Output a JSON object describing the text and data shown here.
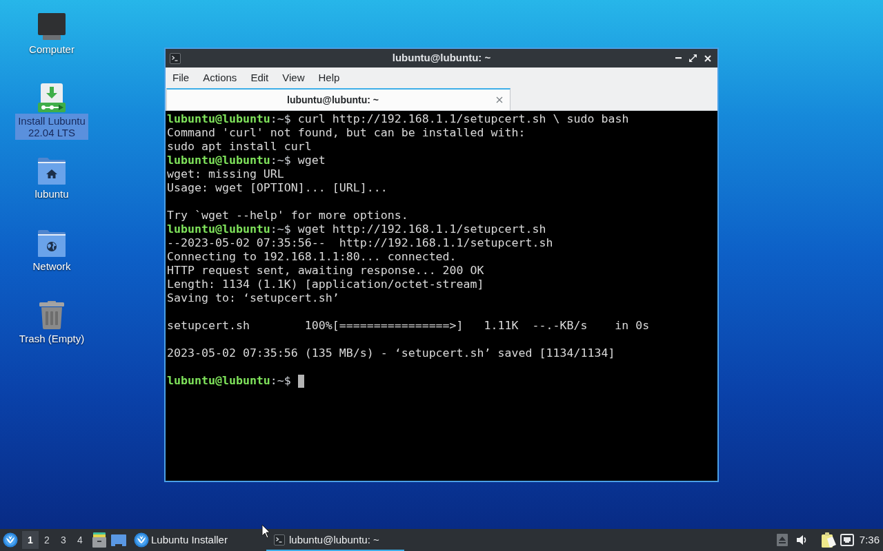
{
  "desktop_icons": [
    {
      "label": "Computer",
      "kind": "computer",
      "selected": false
    },
    {
      "label": "Install Lubuntu 22.04 LTS",
      "kind": "installer",
      "selected": true
    },
    {
      "label": "lubuntu",
      "kind": "home",
      "selected": false
    },
    {
      "label": "Network",
      "kind": "network",
      "selected": false
    },
    {
      "label": "Trash (Empty)",
      "kind": "trash",
      "selected": false
    }
  ],
  "window": {
    "title": "lubuntu@lubuntu: ~",
    "menu": [
      "File",
      "Actions",
      "Edit",
      "View",
      "Help"
    ],
    "tabs": [
      {
        "label": "lubuntu@lubuntu: ~",
        "selected": true
      }
    ]
  },
  "terminal": {
    "lines": [
      {
        "kind": "prompt",
        "user_host": "lubuntu@lubuntu",
        "path": ":~$",
        "command": "curl http://192.168.1.1/setupcert.sh \\ sudo bash"
      },
      {
        "kind": "output",
        "text": "Command 'curl' not found, but can be installed with:"
      },
      {
        "kind": "output",
        "text": "sudo apt install curl"
      },
      {
        "kind": "prompt",
        "user_host": "lubuntu@lubuntu",
        "path": ":~$",
        "command": "wget"
      },
      {
        "kind": "output",
        "text": "wget: missing URL"
      },
      {
        "kind": "output",
        "text": "Usage: wget [OPTION]... [URL]..."
      },
      {
        "kind": "blank"
      },
      {
        "kind": "output",
        "text": "Try `wget --help' for more options."
      },
      {
        "kind": "prompt",
        "user_host": "lubuntu@lubuntu",
        "path": ":~$",
        "command": "wget http://192.168.1.1/setupcert.sh"
      },
      {
        "kind": "output",
        "text": "--2023-05-02 07:35:56--  http://192.168.1.1/setupcert.sh"
      },
      {
        "kind": "output",
        "text": "Connecting to 192.168.1.1:80... connected."
      },
      {
        "kind": "output",
        "text": "HTTP request sent, awaiting response... 200 OK"
      },
      {
        "kind": "output",
        "text": "Length: 1134 (1.1K) [application/octet-stream]"
      },
      {
        "kind": "output",
        "text": "Saving to: ‘setupcert.sh’"
      },
      {
        "kind": "blank"
      },
      {
        "kind": "output",
        "text": "setupcert.sh        100%[================>]   1.11K  --.-KB/s    in 0s"
      },
      {
        "kind": "blank"
      },
      {
        "kind": "output",
        "text": "2023-05-02 07:35:56 (135 MB/s) - ‘setupcert.sh’ saved [1134/1134]"
      },
      {
        "kind": "blank"
      },
      {
        "kind": "prompt",
        "user_host": "lubuntu@lubuntu",
        "path": ":~$"
      }
    ],
    "cursor": true
  },
  "taskbar": {
    "workspaces": [
      {
        "label": "1",
        "selected": true
      },
      {
        "label": "2",
        "selected": false
      },
      {
        "label": "3",
        "selected": false
      },
      {
        "label": "4",
        "selected": false
      }
    ],
    "tasks": [
      {
        "label": "Lubuntu Installer",
        "kind": "installer",
        "selected": false
      },
      {
        "label": "lubuntu@lubuntu: ~",
        "kind": "terminal",
        "selected": true
      }
    ],
    "clock": "7:36"
  }
}
